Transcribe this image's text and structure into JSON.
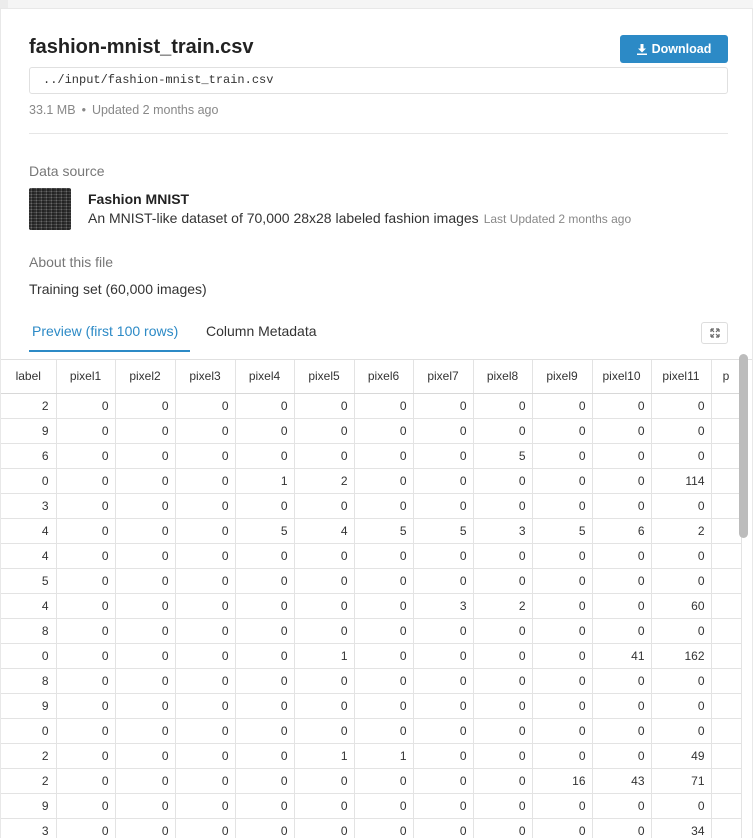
{
  "file": {
    "title": "fashion-mnist_train.csv",
    "path": "../input/fashion-mnist_train.csv",
    "size": "33.1 MB",
    "separator": "•",
    "updated": "Updated 2 months ago",
    "download_label": "Download"
  },
  "data_source": {
    "heading": "Data source",
    "name": "Fashion MNIST",
    "description": "An MNIST-like dataset of 70,000 28x28 labeled fashion images",
    "last_updated": "Last Updated 2 months ago"
  },
  "about": {
    "heading": "About this file",
    "text": "Training set (60,000 images)"
  },
  "tabs": {
    "preview": "Preview (first 100 rows)",
    "metadata": "Column Metadata"
  },
  "table": {
    "columns": [
      "label",
      "pixel1",
      "pixel2",
      "pixel3",
      "pixel4",
      "pixel5",
      "pixel6",
      "pixel7",
      "pixel8",
      "pixel9",
      "pixel10",
      "pixel11",
      "p"
    ],
    "rows": [
      [
        "2",
        "0",
        "0",
        "0",
        "0",
        "0",
        "0",
        "0",
        "0",
        "0",
        "0",
        "0",
        ""
      ],
      [
        "9",
        "0",
        "0",
        "0",
        "0",
        "0",
        "0",
        "0",
        "0",
        "0",
        "0",
        "0",
        ""
      ],
      [
        "6",
        "0",
        "0",
        "0",
        "0",
        "0",
        "0",
        "0",
        "5",
        "0",
        "0",
        "0",
        ""
      ],
      [
        "0",
        "0",
        "0",
        "0",
        "1",
        "2",
        "0",
        "0",
        "0",
        "0",
        "0",
        "114",
        ""
      ],
      [
        "3",
        "0",
        "0",
        "0",
        "0",
        "0",
        "0",
        "0",
        "0",
        "0",
        "0",
        "0",
        ""
      ],
      [
        "4",
        "0",
        "0",
        "0",
        "5",
        "4",
        "5",
        "5",
        "3",
        "5",
        "6",
        "2",
        ""
      ],
      [
        "4",
        "0",
        "0",
        "0",
        "0",
        "0",
        "0",
        "0",
        "0",
        "0",
        "0",
        "0",
        ""
      ],
      [
        "5",
        "0",
        "0",
        "0",
        "0",
        "0",
        "0",
        "0",
        "0",
        "0",
        "0",
        "0",
        ""
      ],
      [
        "4",
        "0",
        "0",
        "0",
        "0",
        "0",
        "0",
        "3",
        "2",
        "0",
        "0",
        "60",
        ""
      ],
      [
        "8",
        "0",
        "0",
        "0",
        "0",
        "0",
        "0",
        "0",
        "0",
        "0",
        "0",
        "0",
        ""
      ],
      [
        "0",
        "0",
        "0",
        "0",
        "0",
        "1",
        "0",
        "0",
        "0",
        "0",
        "41",
        "162",
        ""
      ],
      [
        "8",
        "0",
        "0",
        "0",
        "0",
        "0",
        "0",
        "0",
        "0",
        "0",
        "0",
        "0",
        ""
      ],
      [
        "9",
        "0",
        "0",
        "0",
        "0",
        "0",
        "0",
        "0",
        "0",
        "0",
        "0",
        "0",
        ""
      ],
      [
        "0",
        "0",
        "0",
        "0",
        "0",
        "0",
        "0",
        "0",
        "0",
        "0",
        "0",
        "0",
        ""
      ],
      [
        "2",
        "0",
        "0",
        "0",
        "0",
        "1",
        "1",
        "0",
        "0",
        "0",
        "0",
        "49",
        ""
      ],
      [
        "2",
        "0",
        "0",
        "0",
        "0",
        "0",
        "0",
        "0",
        "0",
        "16",
        "43",
        "71",
        ""
      ],
      [
        "9",
        "0",
        "0",
        "0",
        "0",
        "0",
        "0",
        "0",
        "0",
        "0",
        "0",
        "0",
        ""
      ],
      [
        "3",
        "0",
        "0",
        "0",
        "0",
        "0",
        "0",
        "0",
        "0",
        "0",
        "0",
        "34",
        ""
      ],
      [
        "",
        "",
        "",
        "",
        "",
        "",
        "",
        "",
        "",
        "",
        "",
        "",
        ""
      ]
    ]
  },
  "colors": {
    "accent": "#2c8ac6"
  },
  "icons": {
    "download": "download-icon",
    "expand": "expand-icon",
    "dataset": "dataset-thumbnail"
  }
}
